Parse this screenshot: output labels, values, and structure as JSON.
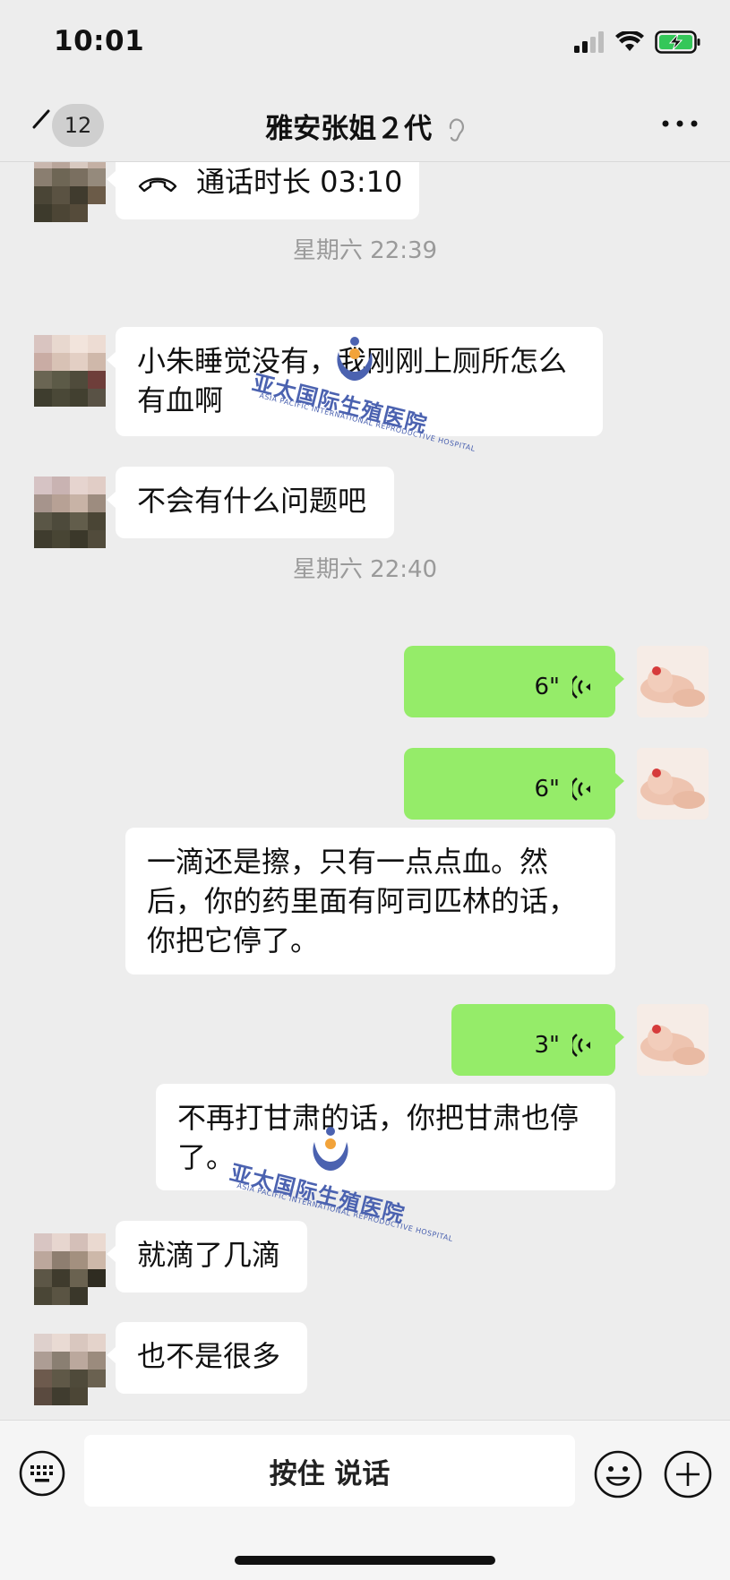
{
  "status": {
    "time": "10:01"
  },
  "nav": {
    "back_badge": "12",
    "title": "雅安张姐２代"
  },
  "messages": {
    "call": {
      "label": "通话时长 03:10"
    },
    "ts1": "星期六 22:39",
    "m1": {
      "text": "小朱睡觉没有，我刚刚上厕所怎么有血啊"
    },
    "m2": {
      "text": "不会有什么问题吧"
    },
    "ts2": "星期六 22:40",
    "v1": {
      "duration": "6\""
    },
    "v2": {
      "duration": "6\""
    },
    "t1": {
      "text": "一滴还是擦，只有一点点血。然后，你的药里面有阿司匹林的话，你把它停了。"
    },
    "v3": {
      "duration": "3\""
    },
    "t2": {
      "text": "不再打甘肃的话，你把甘肃也停了。"
    },
    "m3": {
      "text": "就滴了几滴"
    },
    "m4": {
      "text": "也不是很多"
    }
  },
  "watermark": {
    "text": "亚太国际生殖医院",
    "sub": "ASIA PACIFIC INTERNATIONAL REPRODUCTIVE HOSPITAL"
  },
  "bottom": {
    "talk_label": "按住 说话"
  },
  "icons": {
    "signal": "signal-icon",
    "wifi": "wifi-icon",
    "battery": "battery-charging-icon",
    "back": "back-arrow-icon",
    "ear": "ear-icon",
    "more": "more-icon",
    "phone": "phone-icon",
    "voice": "voice-wave-icon",
    "keyboard": "keyboard-icon",
    "emoji": "emoji-icon",
    "plus": "plus-icon"
  },
  "colors": {
    "background": "#ededed",
    "bubble_self": "#95ec69",
    "bubble_other": "#ffffff",
    "watermark": "#4b62b0"
  }
}
